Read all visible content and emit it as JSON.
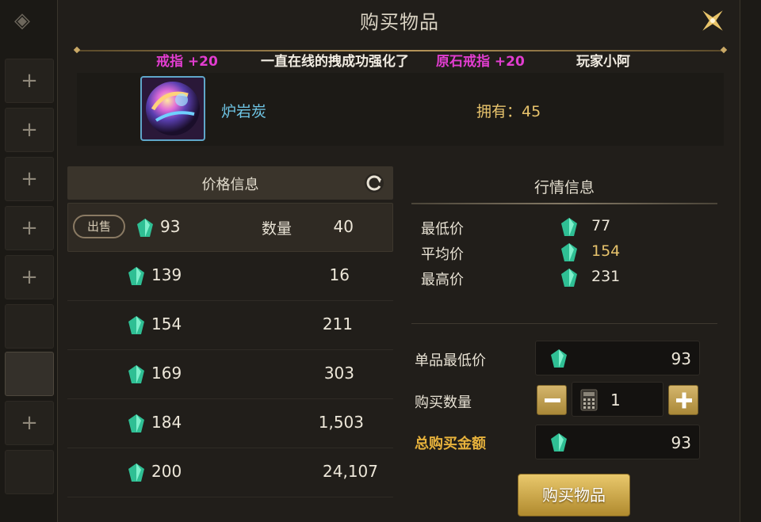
{
  "window": {
    "title": "购买物品"
  },
  "marquee": {
    "segments": [
      {
        "text": "戒指 +20",
        "color": "pink"
      },
      {
        "text": "一直在线的拽成功强化了",
        "color": "white"
      },
      {
        "text": "原石戒指 +20",
        "color": "pink"
      },
      {
        "text": "玩家小阿",
        "color": "white"
      }
    ]
  },
  "item": {
    "name": "炉岩炭",
    "owned_label": "拥有：45"
  },
  "price_info": {
    "header": "价格信息",
    "sell_badge": "出售",
    "qty_label": "数量",
    "rows": [
      {
        "price": "93",
        "qty": "40"
      },
      {
        "price": "139",
        "qty": "16"
      },
      {
        "price": "154",
        "qty": "211"
      },
      {
        "price": "169",
        "qty": "303"
      },
      {
        "price": "184",
        "qty": "1,503"
      },
      {
        "price": "200",
        "qty": "24,107"
      }
    ]
  },
  "market_info": {
    "title": "行情信息",
    "min_label": "最低价",
    "min_value": "77",
    "avg_label": "平均价",
    "avg_value": "154",
    "max_label": "最高价",
    "max_value": "231"
  },
  "purchase": {
    "unit_min_label": "单品最低价",
    "unit_min_value": "93",
    "qty_label": "购买数量",
    "qty_value": "1",
    "total_label": "总购买金额",
    "total_value": "93",
    "buy_label": "购买物品"
  },
  "colors": {
    "accent_pink": "#e23dd0",
    "gold": "#e7c36c",
    "item_name": "#6fc6e6"
  },
  "icons": [
    "close-icon",
    "refresh-icon",
    "gem-icon",
    "calculator-icon",
    "plus-icon",
    "minus-icon"
  ]
}
